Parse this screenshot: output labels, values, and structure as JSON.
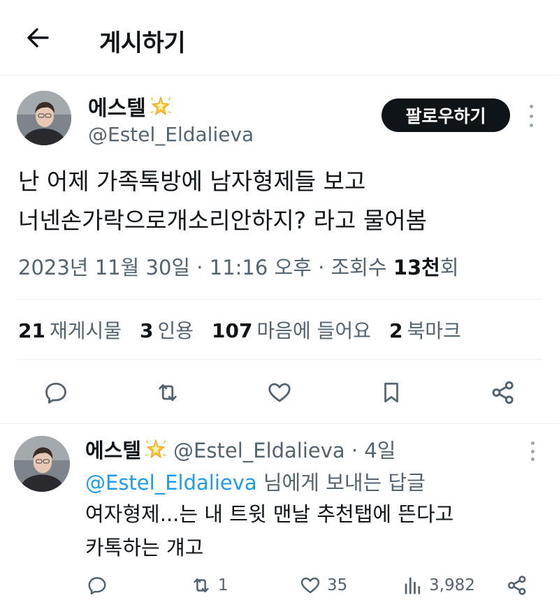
{
  "header": {
    "title": "게시하기"
  },
  "tweet": {
    "author_name": "에스텔",
    "author_handle": "@Estel_Eldalieva",
    "follow_label": "팔로우하기",
    "text_line1": "난 어제 가족톡방에 남자형제들 보고",
    "text_line2": "너넨손가락으로개소리안하지? 라고 물어봄",
    "meta_prefix": "2023년 11월 30일 · 11:16 오후 · 조회수 ",
    "meta_views": "13천",
    "meta_suffix": "회"
  },
  "stats": [
    {
      "count": "21",
      "label": "재게시물"
    },
    {
      "count": "3",
      "label": "인용"
    },
    {
      "count": "107",
      "label": "마음에 들어요"
    },
    {
      "count": "2",
      "label": "북마크"
    }
  ],
  "reply": {
    "author_name": "에스텔",
    "author_handle": "@Estel_Eldalieva · 4일",
    "replying_mention": "@Estel_Eldalieva",
    "replying_suffix": " 님에게 보내는 답글",
    "text_line1": "여자형제...는 내 트윗 맨날 추천탭에 뜬다고",
    "text_line2": "카톡하는 걔고",
    "retweets": "1",
    "likes": "35",
    "views": "3,982"
  },
  "icons": {
    "back": "arrow-left-icon",
    "emoji": "glowing-star-emoji",
    "reply": "reply-icon",
    "retweet": "retweet-icon",
    "like": "heart-icon",
    "bookmark": "bookmark-icon",
    "share": "share-icon",
    "views": "bar-chart-icon",
    "more": "more-vertical-icon"
  },
  "colors": {
    "text": "#0f1419",
    "secondary": "#536471",
    "link": "#1d9bf0",
    "button": "#0f1419"
  }
}
